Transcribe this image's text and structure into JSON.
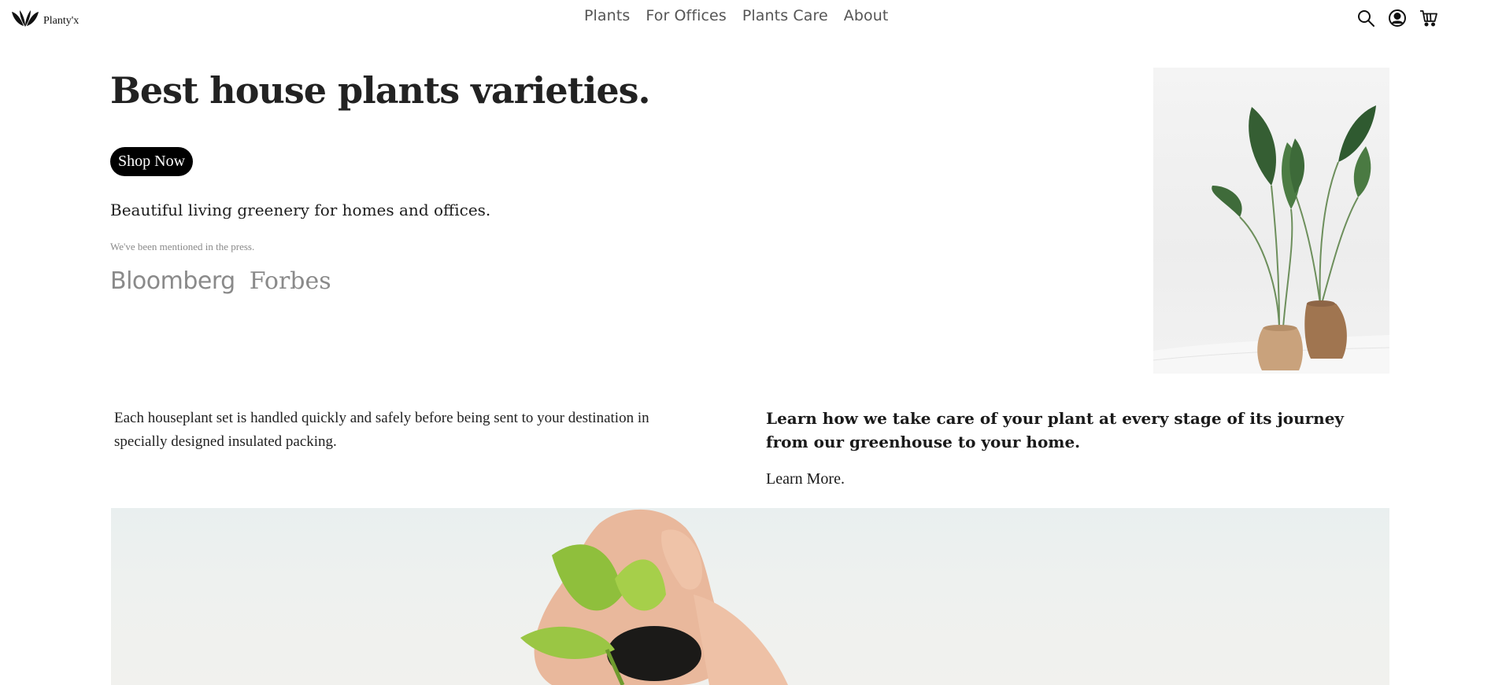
{
  "header": {
    "logo_text": "Planty'x",
    "nav": [
      "Plants",
      "For Offices",
      "Plants Care",
      "About"
    ],
    "icons": [
      "search-icon",
      "user-account-icon",
      "cart-icon"
    ]
  },
  "hero": {
    "title": "Best house plants varieties.",
    "cta_label": "Shop Now",
    "tagline": "Beautiful living greenery for homes and offices.",
    "press_note": "We've been mentioned in the press.",
    "press_logos": [
      "Bloomberg",
      "Forbes"
    ]
  },
  "info": {
    "left_text": "Each houseplant set is handled quickly and safely before being sent to your destination in specially designed insulated packing.",
    "right_heading": "Learn how we take care of your plant at every stage of its journey from our greenhouse to your home.",
    "learn_more_label": "Learn More."
  },
  "colors": {
    "accent": "#000000",
    "muted_text": "#8a8a8a",
    "nav_text": "#555555"
  }
}
